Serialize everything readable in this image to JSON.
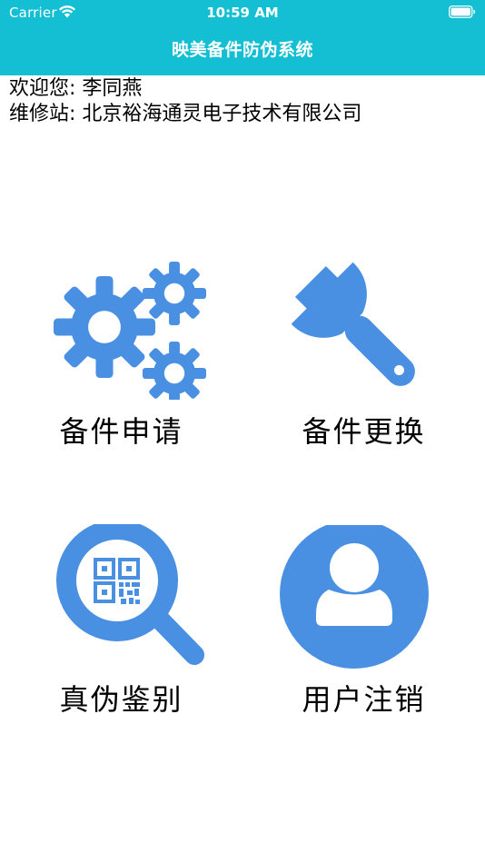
{
  "status_bar": {
    "carrier": "Carrier",
    "time": "10:59 AM",
    "icons": [
      "wifi-icon",
      "battery-icon"
    ]
  },
  "nav": {
    "title": "映美备件防伪系统",
    "color": "#14bfd3"
  },
  "user_info": {
    "welcome": "欢迎您: 李同燕",
    "station": "维修站: 北京裕海通灵电子技术有限公司"
  },
  "menu": {
    "icon_color": "#4a90e2",
    "items": [
      {
        "label": "备件申请",
        "icon": "gears-icon"
      },
      {
        "label": "备件更换",
        "icon": "wrench-icon"
      },
      {
        "label": "真伪鉴别",
        "icon": "qr-magnifier-icon"
      },
      {
        "label": "用户注销",
        "icon": "user-icon"
      }
    ]
  }
}
